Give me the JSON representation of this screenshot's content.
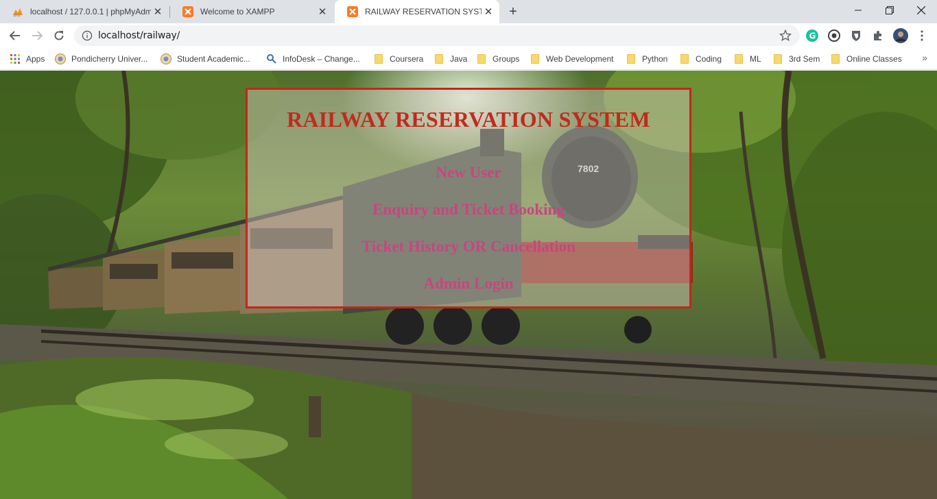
{
  "browser": {
    "tabs": [
      {
        "title": "localhost / 127.0.0.1 | phpMyAdmin",
        "icon": "phpmyadmin-icon",
        "active": false
      },
      {
        "title": "Welcome to XAMPP",
        "icon": "xampp-icon",
        "active": false
      },
      {
        "title": "RAILWAY RESERVATION SYSTEM",
        "icon": "xampp-icon",
        "active": true
      }
    ],
    "url": "localhost/railway/",
    "bookmarks": [
      {
        "label": "Apps",
        "icon": "apps-grid-icon"
      },
      {
        "label": "Pondicherry Univer...",
        "icon": "university-icon"
      },
      {
        "label": "Student Academic...",
        "icon": "university-icon"
      },
      {
        "label": "InfoDesk – Change...",
        "icon": "infodesk-icon"
      },
      {
        "label": "Coursera",
        "icon": "folder-icon"
      },
      {
        "label": "Java",
        "icon": "folder-icon"
      },
      {
        "label": "Groups",
        "icon": "folder-icon"
      },
      {
        "label": "Web Development",
        "icon": "folder-icon"
      },
      {
        "label": "Python",
        "icon": "folder-icon"
      },
      {
        "label": "Coding",
        "icon": "folder-icon"
      },
      {
        "label": "ML",
        "icon": "folder-icon"
      },
      {
        "label": "3rd Sem",
        "icon": "folder-icon"
      },
      {
        "label": "Online Classes",
        "icon": "folder-icon"
      }
    ],
    "more_bookmarks": "»"
  },
  "page": {
    "title": "RAILWAY RESERVATION SYSTEM",
    "links": {
      "new_user": "New User",
      "enquiry": "Enquiry and Ticket Booking",
      "history": "Ticket History OR Cancellation",
      "admin": "Admin Login"
    },
    "engine_number": "7802"
  },
  "colors": {
    "title_red": "#c12a1e",
    "link_pink": "#c9457e",
    "panel_border": "#c1271b"
  }
}
